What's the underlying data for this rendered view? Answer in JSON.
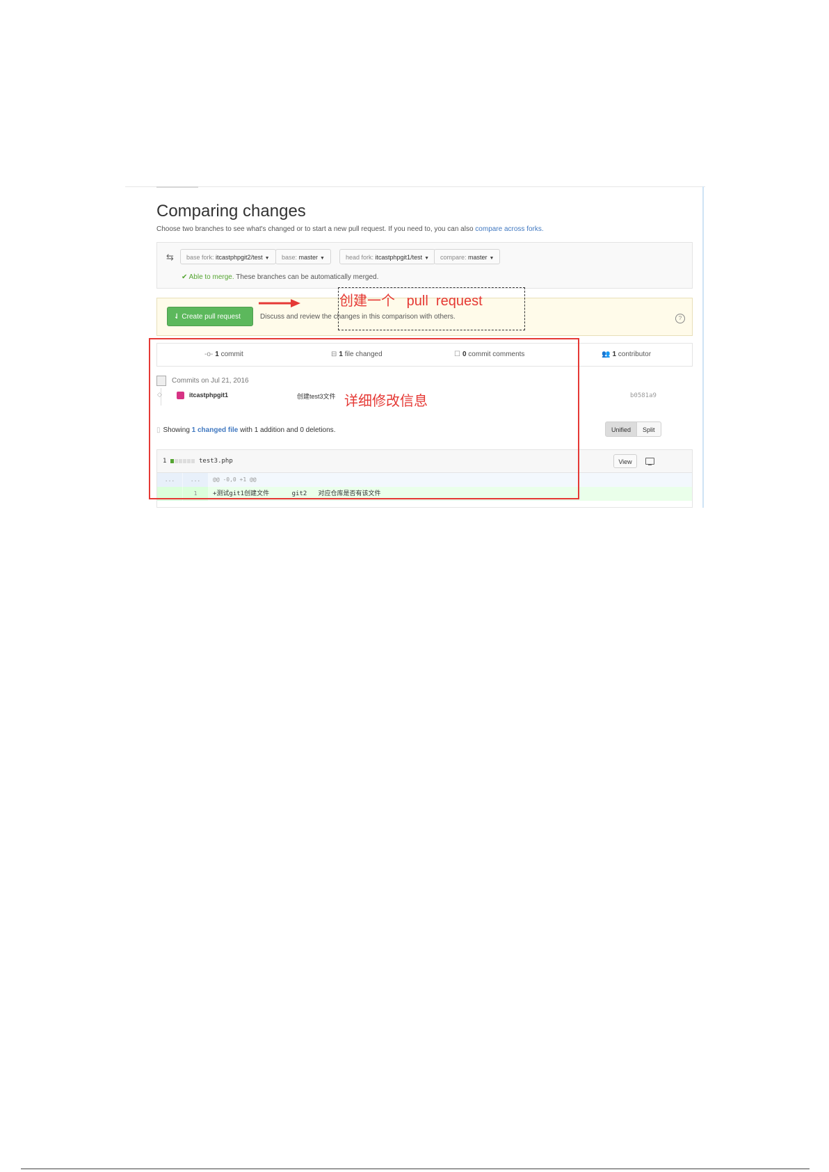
{
  "page": {
    "title": "Comparing changes",
    "subtitle": "Choose two branches to see what's changed or to start a new pull request. If you need to, you can also ",
    "subtitle_link": "compare across forks."
  },
  "range": {
    "base_fork_label": "base fork: ",
    "base_fork_value": "itcastphpgit2/test",
    "base_label": "base: ",
    "base_value": "master",
    "dots": "...",
    "head_fork_label": "head fork: ",
    "head_fork_value": "itcastphpgit1/test",
    "compare_label": "compare: ",
    "compare_value": "master",
    "merge_status": "Able to merge.",
    "merge_detail": " These branches can be automatically merged."
  },
  "pull_request": {
    "button_label": "Create pull request",
    "description": "Discuss and review the changes in this comparison with others."
  },
  "annotations": {
    "create_pr": "创建一个   pull  request",
    "detail_info": "详细修改信息",
    "color": "#e53935"
  },
  "stats": {
    "commits": "1",
    "commits_label": " commit",
    "files": "1",
    "files_label": " file changed",
    "comments": "0",
    "comments_label": " commit comments",
    "contributors": "1",
    "contributors_label": " contributor"
  },
  "commits": {
    "heading": "Commits on Jul 21, 2016",
    "items": [
      {
        "author": "itcastphpgit1",
        "message": "创建test3文件",
        "sha": "b0581a9"
      }
    ]
  },
  "diff_summary": {
    "showing": "Showing ",
    "changed_file": "1 changed file",
    "with": " with ",
    "additions": "1 addition",
    "and": " and ",
    "deletions": "0 deletions",
    "end": ".",
    "unified": "Unified",
    "split": "Split"
  },
  "file": {
    "count": "1",
    "name": "test3.php",
    "view_label": "View",
    "hunk_old": "...",
    "hunk_new": "...",
    "hunk_header": "@@ -0,0 +1 @@",
    "line_number": "1",
    "added_line": "+测试git1创建文件      git2   对应仓库是否有该文件",
    "colors": {
      "addition": "#55a532",
      "link": "#4078c0",
      "button": "#5cb85c"
    }
  }
}
